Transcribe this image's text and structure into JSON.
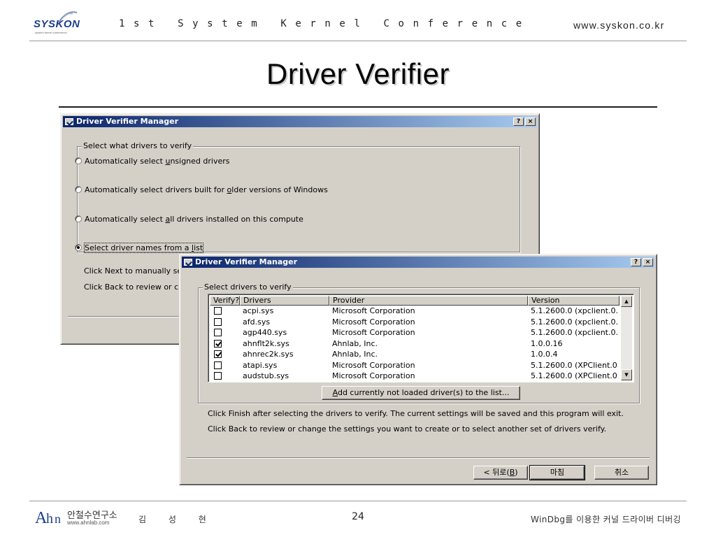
{
  "header": {
    "logo_text": "SYSKON",
    "logo_sub": "system kernel conference",
    "conference": "1st System Kernel Conference",
    "url": "www.syskon.co.kr"
  },
  "slide": {
    "title": "Driver Verifier",
    "page": "24"
  },
  "dialog1": {
    "title": "Driver Verifier Manager",
    "help_btn": "?",
    "close_btn": "×",
    "group_label": "Select what drivers to verify",
    "options": [
      {
        "pre": "Automatically select ",
        "key": "u",
        "post": "nsigned drivers",
        "checked": false
      },
      {
        "pre": "Automatically select drivers built for ",
        "key": "o",
        "post": "lder versions of Windows",
        "checked": false
      },
      {
        "pre": "Automatically select ",
        "key": "a",
        "post": "ll drivers installed on this compute",
        "checked": false
      },
      {
        "pre": "Select driver names from a ",
        "key": "l",
        "post": "ist",
        "checked": true
      }
    ],
    "hint_next": "Click Next to manually sel",
    "hint_back": "Click Back to review or ch"
  },
  "dialog2": {
    "title": "Driver Verifier Manager",
    "help_btn": "?",
    "close_btn": "×",
    "group_label": "Select drivers to verify",
    "columns": [
      "Verify?",
      "Drivers",
      "Provider",
      "Version"
    ],
    "rows": [
      {
        "verify": false,
        "driver": "acpi.sys",
        "provider": "Microsoft Corporation",
        "version": "5.1.2600.0 (xpclient.0..."
      },
      {
        "verify": false,
        "driver": "afd.sys",
        "provider": "Microsoft Corporation",
        "version": "5.1.2600.0 (xpclient.0..."
      },
      {
        "verify": false,
        "driver": "agp440.sys",
        "provider": "Microsoft Corporation",
        "version": "5.1.2600.0 (xpclient.0..."
      },
      {
        "verify": true,
        "driver": "ahnflt2k.sys",
        "provider": "Ahnlab, Inc.",
        "version": "1.0.0.16"
      },
      {
        "verify": true,
        "driver": "ahnrec2k.sys",
        "provider": "Ahnlab, Inc.",
        "version": "1.0.0.4"
      },
      {
        "verify": false,
        "driver": "atapi.sys",
        "provider": "Microsoft Corporation",
        "version": "5.1.2600.0 (XPClient.0..."
      },
      {
        "verify": false,
        "driver": "audstub.sys",
        "provider": "Microsoft Corporation",
        "version": "5.1.2600.0 (XPClient.0..."
      }
    ],
    "add_button": {
      "key": "A",
      "rest": "dd currently not loaded driver(s) to the list..."
    },
    "info_finish": "Click Finish after selecting the drivers to verify. The current settings will be saved and this program will exit.",
    "info_back": "Click Back to review or change the settings you want to create or to select another set of drivers verify.",
    "back_btn": {
      "pre": "< 뒤로(",
      "key": "B",
      "post": ")"
    },
    "finish_btn": "마침",
    "cancel_btn": "취소"
  },
  "footer": {
    "company": "안철수연구소",
    "company_url": "www.ahnlab.com",
    "author": "김 성 현",
    "note": "WinDbg를 이용한 커널 드라이버 디버깅"
  }
}
